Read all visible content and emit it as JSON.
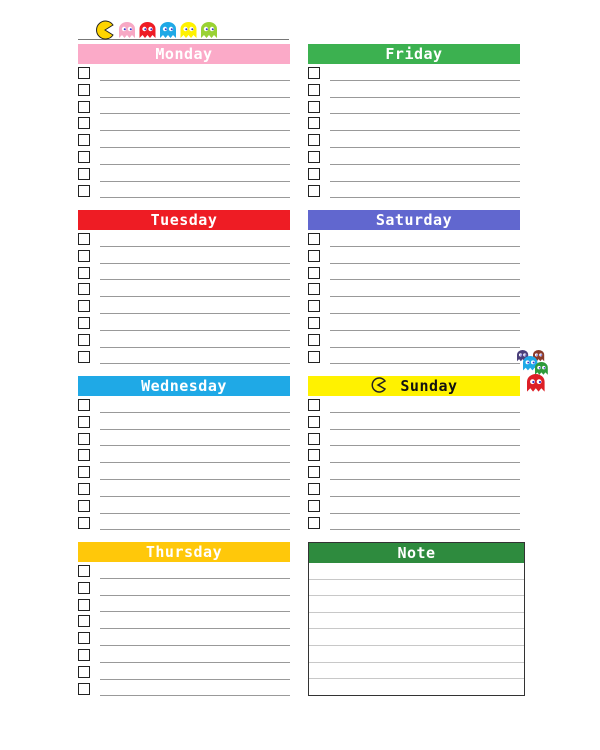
{
  "days": [
    {
      "label": "Monday",
      "color": "#fbaac8",
      "text_color": "#ffffff",
      "rows": 8
    },
    {
      "label": "Tuesday",
      "color": "#ee1c24",
      "text_color": "#ffffff",
      "rows": 8
    },
    {
      "label": "Wednesday",
      "color": "#1fa9e6",
      "text_color": "#ffffff",
      "rows": 8
    },
    {
      "label": "Thursday",
      "color": "#ffc80a",
      "text_color": "#ffffff",
      "rows": 8
    },
    {
      "label": "Friday",
      "color": "#3cb150",
      "text_color": "#ffffff",
      "rows": 8
    },
    {
      "label": "Saturday",
      "color": "#6167cf",
      "text_color": "#ffffff",
      "rows": 8
    },
    {
      "label": "Sunday",
      "color": "#fff200",
      "text_color": "#111111",
      "rows": 8
    }
  ],
  "note": {
    "label": "Note",
    "color": "#2e8b3e",
    "lines": 8
  },
  "decor": {
    "top_icons": [
      "pacman-icon",
      "ghost-pink-icon",
      "ghost-red-icon",
      "ghost-blue-icon",
      "ghost-yellow-icon",
      "ghost-green-icon"
    ],
    "ghost_colors": [
      "#f7a8c4",
      "#ee1c24",
      "#1fa9e6",
      "#fff200",
      "#9ad234"
    ],
    "side_ghost_colors": [
      "#4a3f7a",
      "#8a3a2a",
      "#1fa9e6",
      "#2e9a3a",
      "#dd1f26"
    ]
  }
}
